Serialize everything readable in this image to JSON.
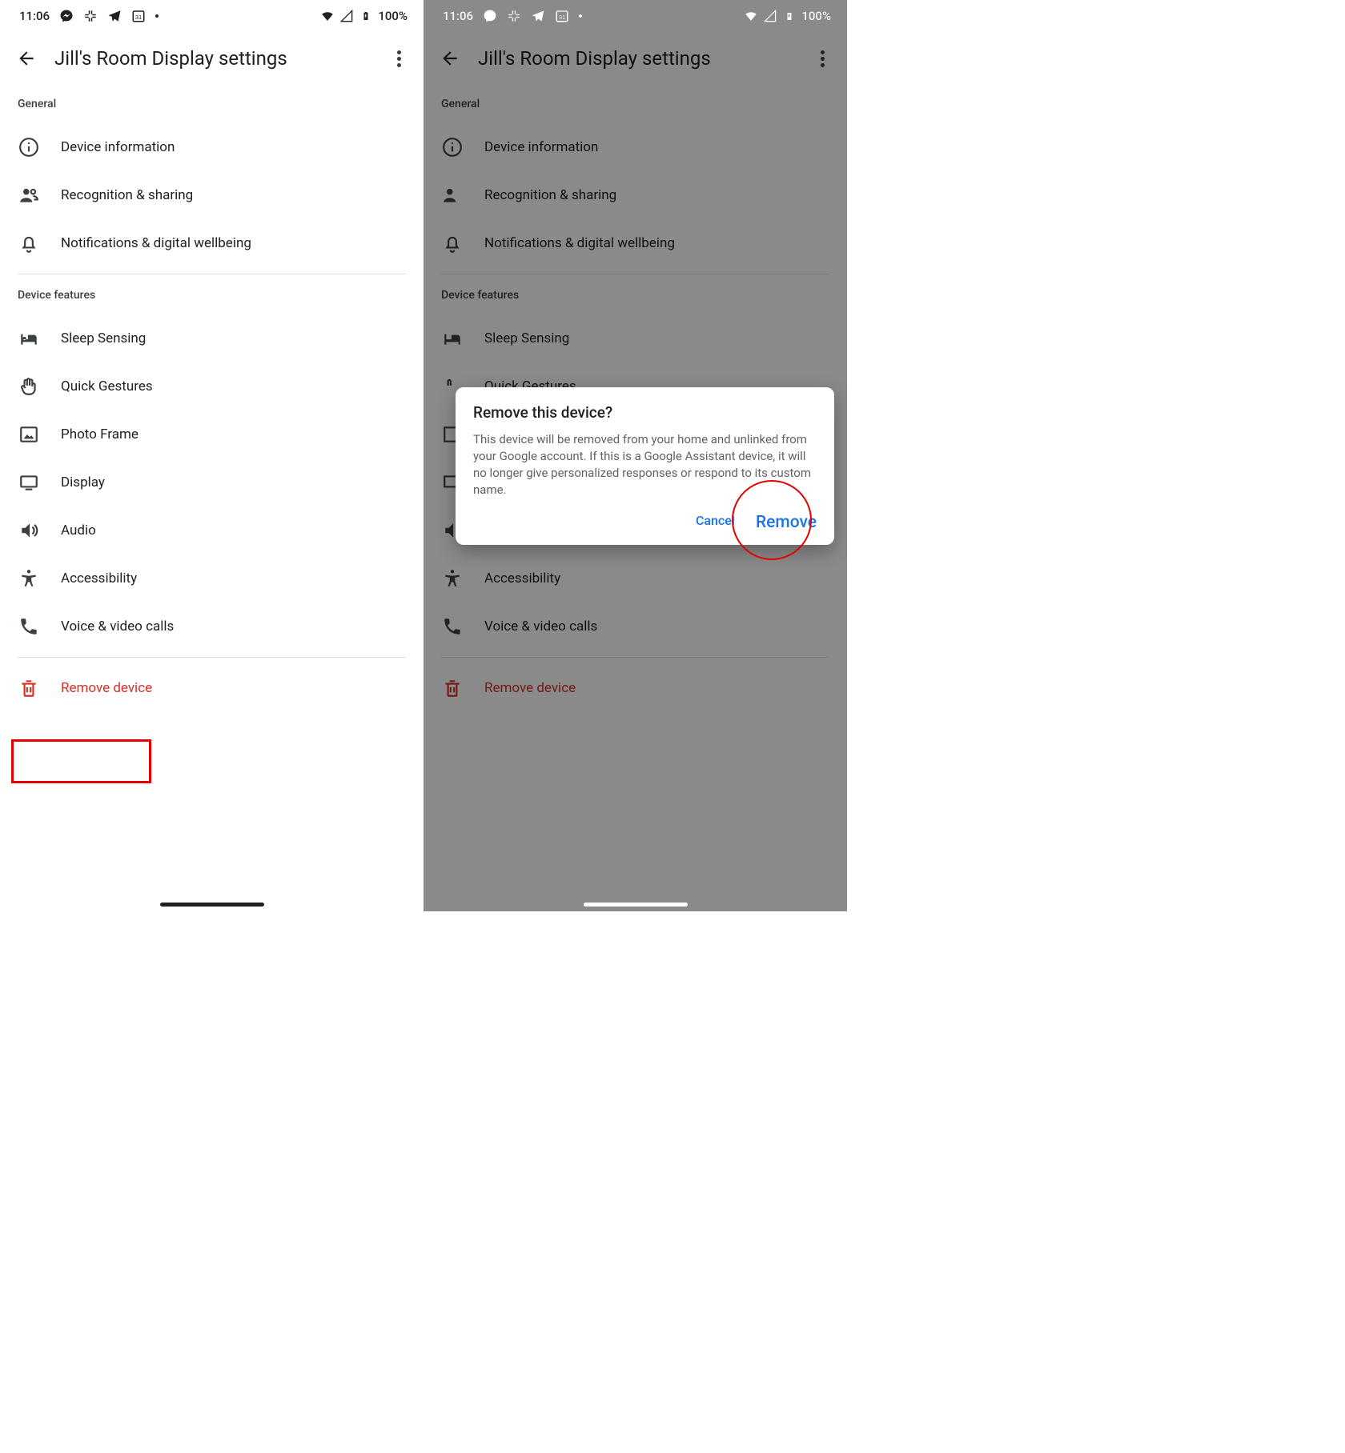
{
  "statusbar": {
    "time": "11:06",
    "battery_text": "100%",
    "calendar_day": "31"
  },
  "appbar": {
    "title": "Jill's Room Display settings"
  },
  "sections": {
    "general_label": "General",
    "device_features_label": "Device features"
  },
  "rows": {
    "device_info": "Device information",
    "recognition": "Recognition & sharing",
    "notifications": "Notifications & digital wellbeing",
    "sleep_sensing": "Sleep Sensing",
    "quick_gestures": "Quick Gestures",
    "photo_frame": "Photo Frame",
    "display": "Display",
    "audio": "Audio",
    "accessibility": "Accessibility",
    "voice_video": "Voice & video calls",
    "remove_device": "Remove device"
  },
  "dialog": {
    "title": "Remove this device?",
    "body": "This device will be removed from your home and unlinked from your Google account. If this is a Google Assistant device, it will no longer give personalized responses or respond to its custom name.",
    "cancel": "Cancel",
    "remove": "Remove"
  }
}
